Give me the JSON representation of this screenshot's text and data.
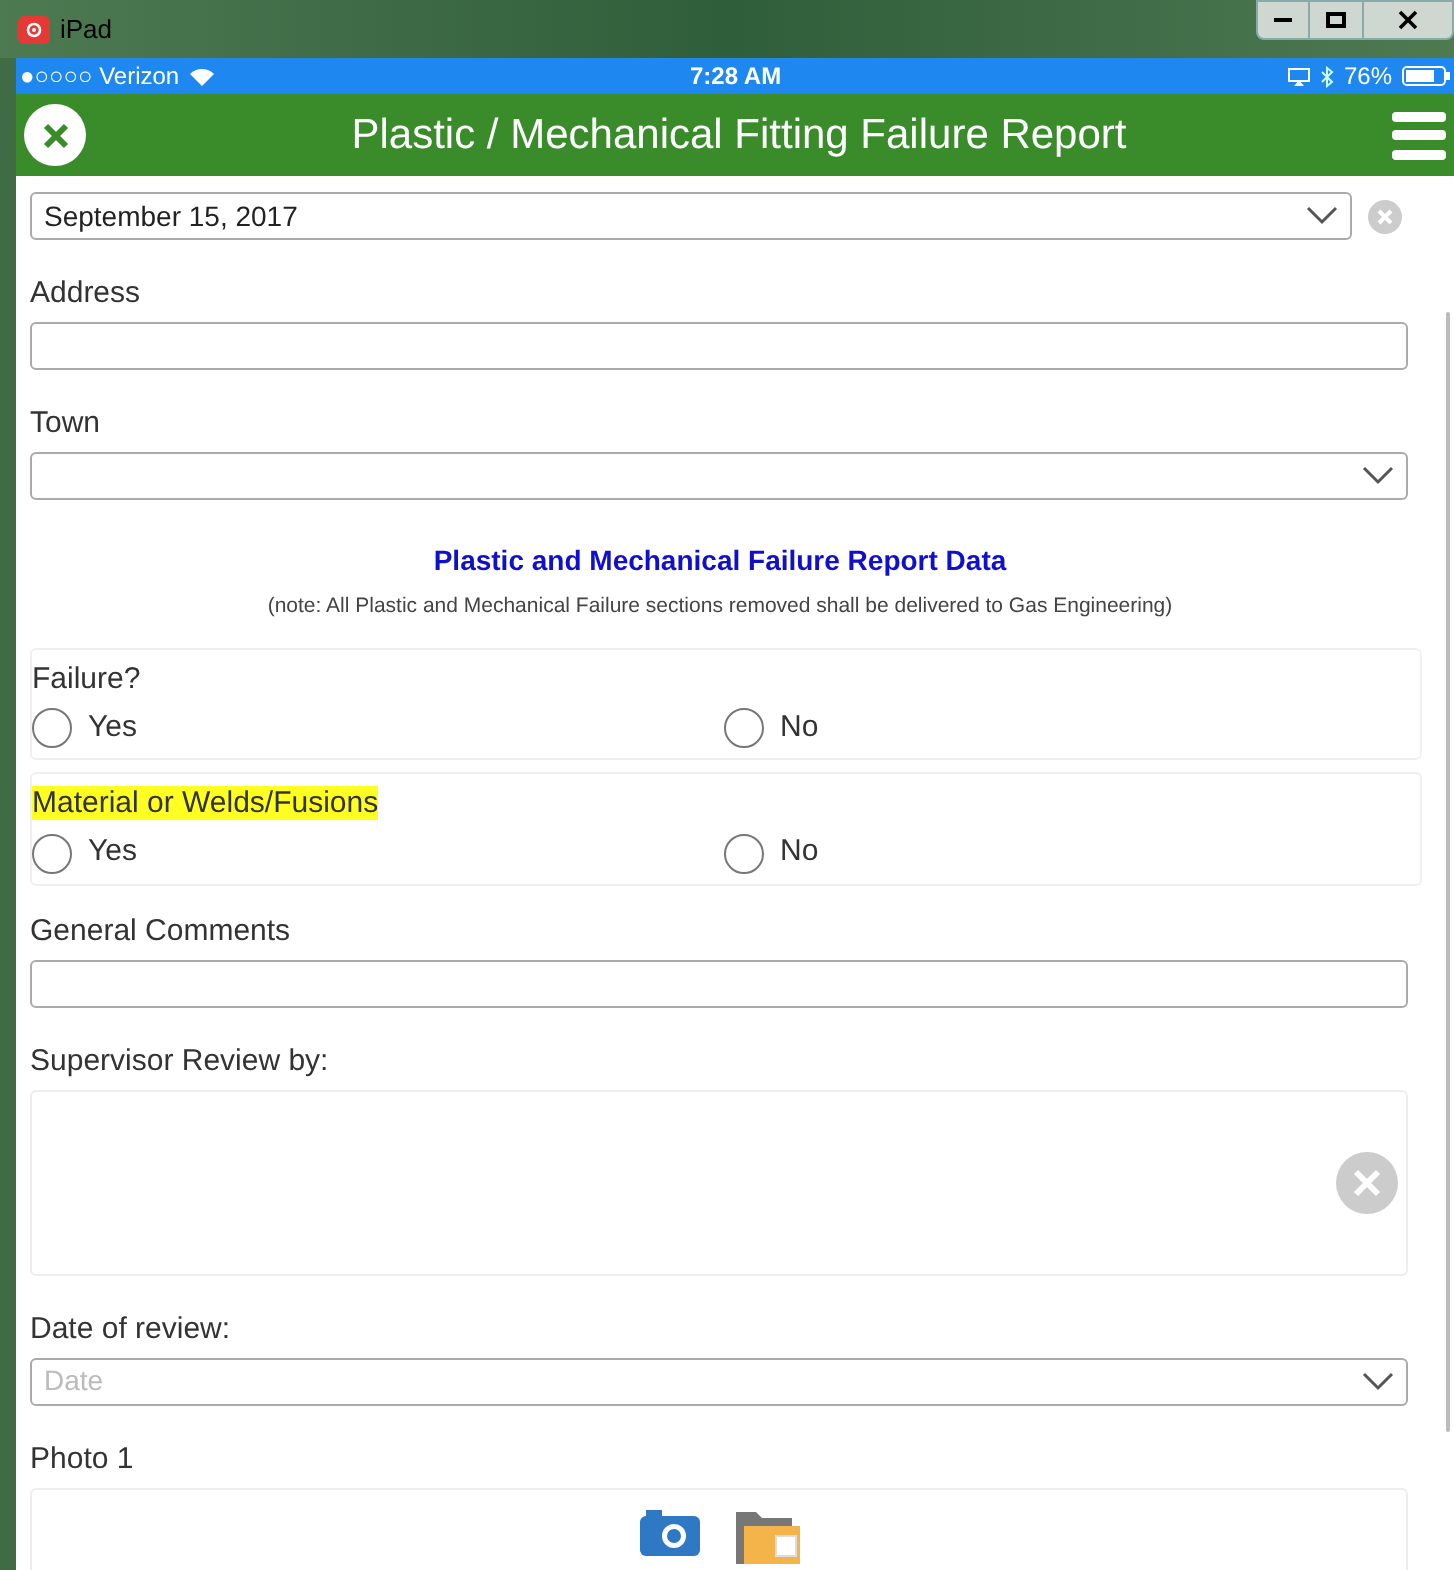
{
  "window": {
    "title": "iPad"
  },
  "status_bar": {
    "carrier": "●○○○○ Verizon",
    "time": "7:28 AM",
    "battery": "76%"
  },
  "header": {
    "title": "Plastic / Mechanical Fitting Failure Report"
  },
  "inspection_date": {
    "value": "September 15, 2017"
  },
  "fields": [
    {
      "kind": "text",
      "label": "Address"
    },
    {
      "kind": "select",
      "label": "Town"
    }
  ],
  "section": {
    "title": "Plastic and Mechanical Failure Report Data",
    "note": "(note: All Plastic and Mechanical Failure sections removed shall be delivered to Gas Engineering)"
  },
  "questions": [
    {
      "label": "Failure?",
      "highlighted": false,
      "options": [
        {
          "label": "Yes",
          "selected": false
        },
        {
          "label": "No",
          "selected": false
        }
      ]
    },
    {
      "label": "Material or Welds/Fusions",
      "highlighted": true,
      "options": [
        {
          "label": "Yes",
          "selected": false
        },
        {
          "label": "No",
          "selected": false
        }
      ]
    }
  ],
  "general_comments": {
    "label": "General Comments"
  },
  "supervisor": {
    "label": "Supervisor Review by:"
  },
  "review_date": {
    "label": "Date of review:",
    "placeholder": "Date"
  },
  "photo": {
    "label": "Photo 1"
  }
}
